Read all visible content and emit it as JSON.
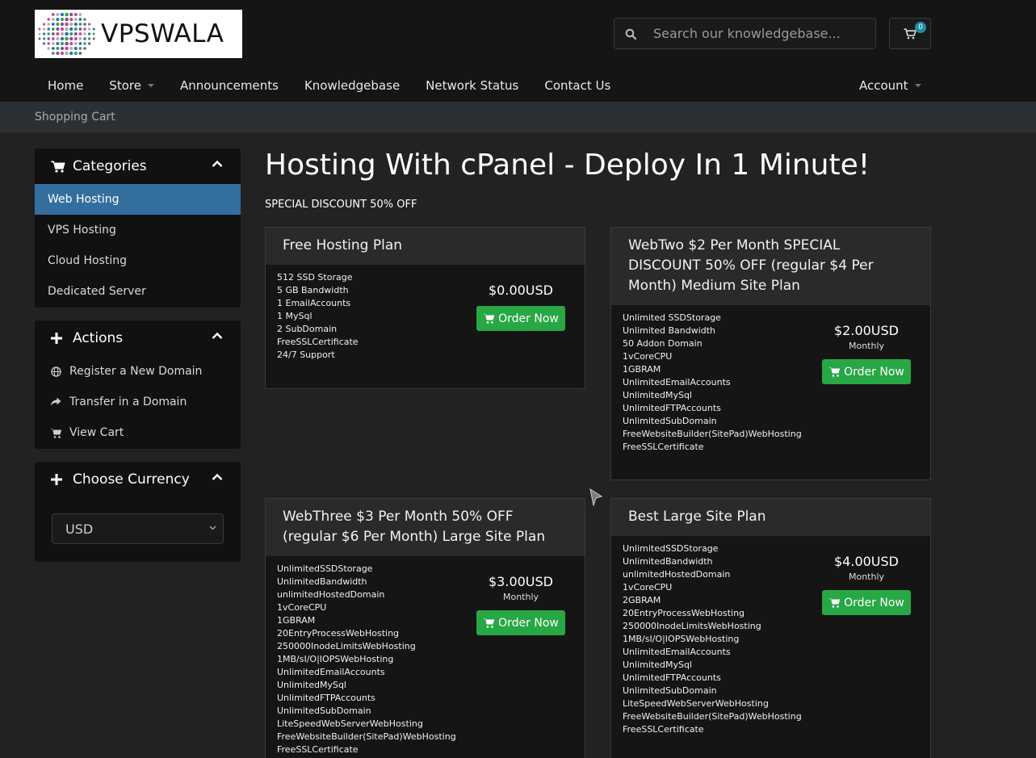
{
  "header": {
    "logo_text": "VPSWALA",
    "search_placeholder": "Search our knowledgebase...",
    "cart_count": "0",
    "nav": [
      {
        "label": "Home",
        "dropdown": false
      },
      {
        "label": "Store",
        "dropdown": true
      },
      {
        "label": "Announcements",
        "dropdown": false
      },
      {
        "label": "Knowledgebase",
        "dropdown": false
      },
      {
        "label": "Network Status",
        "dropdown": false
      },
      {
        "label": "Contact Us",
        "dropdown": false
      }
    ],
    "account_label": "Account"
  },
  "breadcrumb": "Shopping Cart",
  "sidebar": {
    "categories": {
      "title": "Categories",
      "items": [
        "Web Hosting",
        "VPS Hosting",
        "Cloud Hosting",
        "Dedicated Server"
      ],
      "active_index": 0
    },
    "actions": {
      "title": "Actions",
      "items": [
        {
          "label": "Register a New Domain",
          "icon": "globe-icon"
        },
        {
          "label": "Transfer in a Domain",
          "icon": "share-icon"
        },
        {
          "label": "View Cart",
          "icon": "cart-icon"
        }
      ]
    },
    "currency": {
      "title": "Choose Currency",
      "selected": "USD"
    }
  },
  "main": {
    "title": "Hosting With cPanel - Deploy In 1 Minute!",
    "subtitle": "SPECIAL DISCOUNT 50% OFF",
    "order_label": "Order Now",
    "products": [
      {
        "name": "Free Hosting Plan",
        "price": "$0.00USD",
        "cycle": "",
        "features": [
          "512 SSD Storage",
          "5 GB Bandwidth",
          "1 EmailAccounts",
          "1 MySql",
          "2 SubDomain",
          "FreeSSLCertificate",
          "24/7 Support"
        ]
      },
      {
        "name": "WebTwo $2 Per Month SPECIAL DISCOUNT 50% OFF (regular $4 Per Month) Medium Site Plan",
        "price": "$2.00USD",
        "cycle": "Monthly",
        "features": [
          "Unlimited SSDStorage",
          "Unlimited Bandwidth",
          "50 Addon Domain",
          "1vCoreCPU",
          "1GBRAM",
          "UnlimitedEmailAccounts",
          "UnlimitedMySql",
          "UnlimitedFTPAccounts",
          "UnlimitedSubDomain",
          "FreeWebsiteBuilder(SitePad)WebHosting",
          "FreeSSLCertificate"
        ]
      },
      {
        "name": "WebThree $3 Per Month 50% OFF (regular $6 Per Month) Large Site Plan",
        "price": "$3.00USD",
        "cycle": "Monthly",
        "features": [
          "UnlimitedSSDStorage",
          "UnlimitedBandwidth",
          "unlimitedHostedDomain",
          "1vCoreCPU",
          "1GBRAM",
          "20EntryProcessWebHosting",
          "250000InodeLimitsWebHosting",
          "1MB/sI/O|IOPSWebHosting",
          "UnlimitedEmailAccounts",
          "UnlimitedMySql",
          "UnlimitedFTPAccounts",
          "UnlimitedSubDomain",
          "LiteSpeedWebServerWebHosting",
          "FreeWebsiteBuilder(SitePad)WebHosting",
          "FreeSSLCertificate"
        ]
      },
      {
        "name": "Best Large Site Plan",
        "price": "$4.00USD",
        "cycle": "Monthly",
        "features": [
          "UnlimitedSSDStorage",
          "UnlimitedBandwidth",
          "unlimitedHostedDomain",
          "1vCoreCPU",
          "2GBRAM",
          "20EntryProcessWebHosting",
          "250000InodeLimitsWebHosting",
          "1MB/sI/O|IOPSWebHosting",
          "UnlimitedEmailAccounts",
          "UnlimitedMySql",
          "UnlimitedFTPAccounts",
          "UnlimitedSubDomain",
          "LiteSpeedWebServerWebHosting",
          "FreeWebsiteBuilder(SitePad)WebHosting",
          "FreeSSLCertificate"
        ]
      }
    ]
  },
  "colors": {
    "background": "#222222",
    "header": "#151515",
    "active": "#336e9e",
    "order_button": "#28a745",
    "badge": "#1f8fa3"
  }
}
